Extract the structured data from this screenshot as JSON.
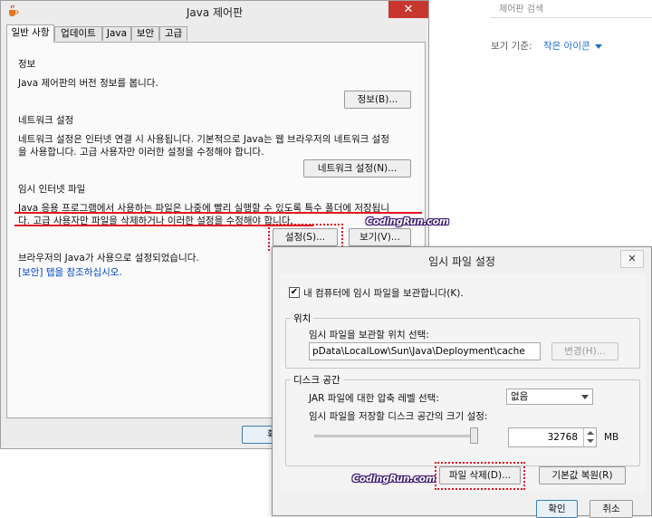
{
  "background": {
    "search_placeholder": "제어판 검색",
    "view_by_label": "보기 기준:",
    "view_by_value": "작은 아이콘"
  },
  "java_panel": {
    "title": "Java 제어판",
    "close_glyph": "✕",
    "tabs": [
      "일반 사항",
      "업데이트",
      "Java",
      "보안",
      "고급"
    ],
    "sections": {
      "info_heading": "정보",
      "info_text": "Java 제어판의 버전 정보를 봅니다.",
      "info_button": "정보(B)...",
      "network_heading": "네트워크 설정",
      "network_text_1": "네트워크 설정은 인터넷 연결 시 사용됩니다. 기본적으로 Java는 웹 브라우저의 네트워크 설정",
      "network_text_2": "을 사용합니다. 고급 사용자만 이러한 설정을 수정해야 합니다.",
      "network_button": "네트워크 설정(N)...",
      "temp_heading": "임시 인터넷 파일",
      "temp_text_1": "Java 응용 프로그램에서 사용하는 파일은 나중에 빨리 실행할 수 있도록 특수 폴더에 저장됩니",
      "temp_text_2": "다. 고급 사용자만 파일을 삭제하거나 이러한 설정을 수정해야 합니다.",
      "settings_button": "설정(S)...",
      "view_button": "보기(V)...",
      "browser_text": "브라우저의 Java가 사용으로 설정되었습니다.",
      "security_link": "[보안] 탭을 참조하십시오."
    },
    "ok_button_partial": "확"
  },
  "watermark": "CodingRun.com",
  "temp_dialog": {
    "title": "임시 파일 설정",
    "close_glyph": "✕",
    "keep_checkbox_label": "내 컴퓨터에 임시 파일을 보관합니다(K).",
    "keep_checked": true,
    "checkmark": "✔",
    "location_group": "위치",
    "location_label": "임시 파일을 보관할 위치 선택:",
    "location_value": "pData\\LocalLow\\Sun\\Java\\Deployment\\cache",
    "change_button": "변경(H)...",
    "disk_group": "디스크 공간",
    "compression_label": "JAR 파일에 대한 압축 레벨 선택:",
    "compression_value": "없음",
    "disk_size_label": "임시 파일을 저장할 디스크 공간의 크기 설정:",
    "disk_size_value": "32768",
    "disk_size_unit": "MB",
    "slider_level": 0.98,
    "delete_button": "파일 삭제(D)...",
    "restore_button": "기본값 복원(R)",
    "ok_button": "확인",
    "cancel_button": "취소"
  }
}
